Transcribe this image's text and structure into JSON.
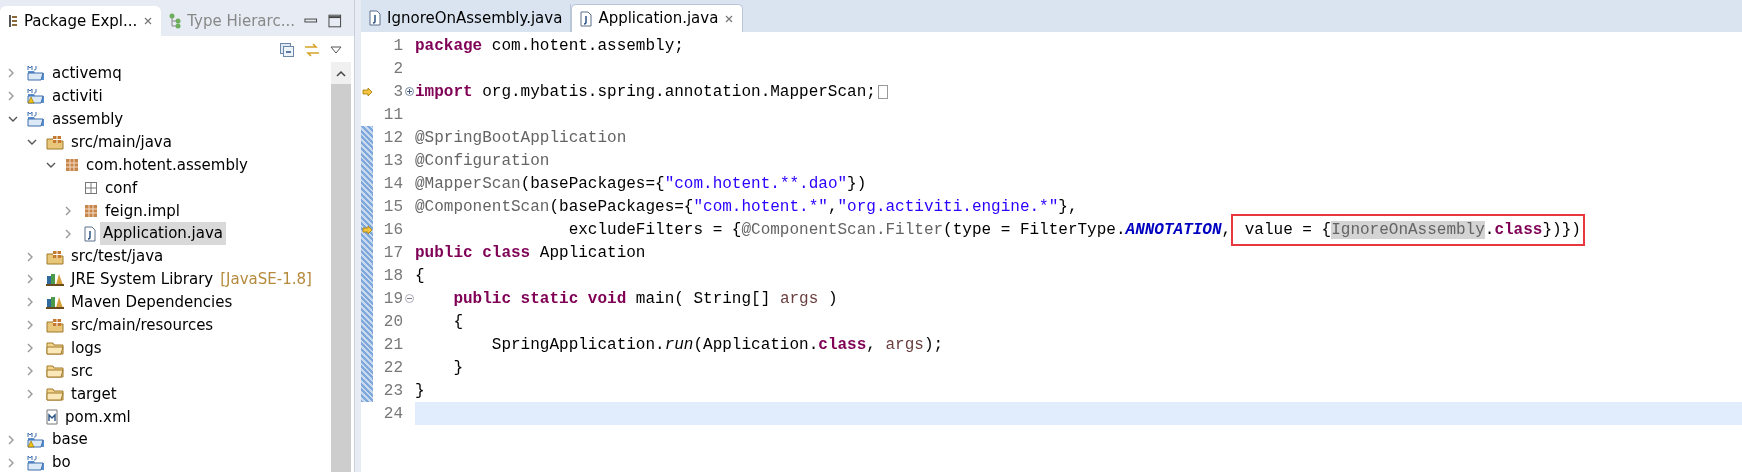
{
  "explorer": {
    "tabs": [
      {
        "label": "Package Expl...",
        "selected": true
      },
      {
        "label": "Type Hierarc...",
        "selected": false
      }
    ],
    "tree": [
      {
        "label": "activemq",
        "kind": "project",
        "warning": false,
        "expanded": false,
        "selected": false
      },
      {
        "label": "activiti",
        "kind": "project",
        "warning": true,
        "expanded": false,
        "selected": false
      },
      {
        "label": "assembly",
        "kind": "project",
        "warning": false,
        "expanded": true,
        "selected": false,
        "children": [
          {
            "label": "src/main/java",
            "kind": "source-folder",
            "expanded": true,
            "selected": false,
            "children": [
              {
                "label": "com.hotent.assembly",
                "kind": "package",
                "expanded": true,
                "selected": false,
                "children": [
                  {
                    "label": "conf",
                    "kind": "empty-package",
                    "selected": false
                  },
                  {
                    "label": "feign.impl",
                    "kind": "package",
                    "expanded": false,
                    "selected": false
                  },
                  {
                    "label": "Application.java",
                    "kind": "java-file",
                    "expanded": false,
                    "selected": true
                  }
                ]
              }
            ]
          },
          {
            "label": "src/test/java",
            "kind": "source-folder",
            "expanded": false,
            "selected": false
          },
          {
            "label": "JRE System Library",
            "decoration": "[JavaSE-1.8]",
            "kind": "library",
            "expanded": false,
            "selected": false
          },
          {
            "label": "Maven Dependencies",
            "kind": "library",
            "expanded": false,
            "selected": false
          },
          {
            "label": "src/main/resources",
            "kind": "source-folder",
            "expanded": false,
            "selected": false
          },
          {
            "label": "logs",
            "kind": "folder",
            "expanded": false,
            "selected": false
          },
          {
            "label": "src",
            "kind": "folder",
            "expanded": false,
            "selected": false
          },
          {
            "label": "target",
            "kind": "folder",
            "expanded": false,
            "selected": false
          },
          {
            "label": "pom.xml",
            "kind": "xml-file",
            "selected": false
          }
        ]
      },
      {
        "label": "base",
        "kind": "project",
        "warning": true,
        "expanded": false,
        "selected": false
      },
      {
        "label": "bo",
        "kind": "project",
        "warning": false,
        "expanded": false,
        "selected": false
      }
    ]
  },
  "editor": {
    "tabs": [
      {
        "label": "IgnoreOnAssembly.java",
        "selected": false,
        "closable": false
      },
      {
        "label": "Application.java",
        "selected": true,
        "closable": true
      }
    ],
    "lines": [
      {
        "number": "1",
        "arrow_marker": false,
        "changed": false,
        "current": false,
        "tokens": [
          {
            "kind": "keyword",
            "text": "package"
          },
          {
            "kind": "plain",
            "text": " com.hotent.assembly;"
          }
        ]
      },
      {
        "number": "2",
        "arrow_marker": false,
        "changed": false,
        "current": false
      },
      {
        "number": "3",
        "arrow_marker": true,
        "collapsed": true,
        "changed": false,
        "current": false,
        "folded_block": true,
        "tokens": [
          {
            "kind": "keyword",
            "text": "import"
          },
          {
            "kind": "plain",
            "text": " org.mybatis.spring.annotation.MapperScan;"
          }
        ]
      },
      {
        "number": "11",
        "arrow_marker": false,
        "changed": false,
        "current": false
      },
      {
        "number": "12",
        "arrow_marker": false,
        "changed": true,
        "current": false,
        "tokens": [
          {
            "kind": "annotation",
            "text": "@SpringBootApplication"
          }
        ]
      },
      {
        "number": "13",
        "arrow_marker": false,
        "changed": true,
        "current": false,
        "tokens": [
          {
            "kind": "annotation",
            "text": "@Configuration"
          }
        ]
      },
      {
        "number": "14",
        "arrow_marker": false,
        "changed": true,
        "current": false,
        "tokens": [
          {
            "kind": "annotation",
            "text": "@MapperScan"
          },
          {
            "kind": "plain",
            "text": "(basePackages={"
          },
          {
            "kind": "string",
            "text": "\"com.hotent.**.dao\""
          },
          {
            "kind": "plain",
            "text": "})"
          }
        ]
      },
      {
        "number": "15",
        "arrow_marker": false,
        "changed": true,
        "current": false,
        "tokens": [
          {
            "kind": "annotation",
            "text": "@ComponentScan"
          },
          {
            "kind": "plain",
            "text": "(basePackages={"
          },
          {
            "kind": "string",
            "text": "\"com.hotent.*\""
          },
          {
            "kind": "plain",
            "text": ","
          },
          {
            "kind": "string",
            "text": "\"org.activiti.engine.*\""
          },
          {
            "kind": "plain",
            "text": "},"
          }
        ]
      },
      {
        "number": "16",
        "arrow_marker": true,
        "changed": true,
        "current": false,
        "tokens": [
          {
            "kind": "plain",
            "text": "                excludeFilters = {"
          },
          {
            "kind": "annotation",
            "text": "@ComponentScan.Filter"
          },
          {
            "kind": "plain",
            "text": "(type = FilterType."
          },
          {
            "kind": "constant",
            "text": "ANNOTATION"
          },
          {
            "kind": "plain",
            "text": ","
          }
        ],
        "boxed_tokens": [
          {
            "kind": "plain",
            "text": " value = {"
          },
          {
            "kind": "occurrence",
            "text": "IgnoreOnAssembly"
          },
          {
            "kind": "plain",
            "text": "."
          },
          {
            "kind": "keyword",
            "text": "class"
          },
          {
            "kind": "plain",
            "text": "})})"
          }
        ]
      },
      {
        "number": "17",
        "arrow_marker": false,
        "changed": true,
        "current": false,
        "tokens": [
          {
            "kind": "keyword",
            "text": "public"
          },
          {
            "kind": "keyword",
            "text": " class"
          },
          {
            "kind": "plain",
            "text": " Application"
          }
        ]
      },
      {
        "number": "18",
        "arrow_marker": false,
        "changed": true,
        "current": false,
        "tokens": [
          {
            "kind": "plain",
            "text": "{"
          }
        ]
      },
      {
        "number": "19",
        "arrow_marker": false,
        "collapsed": false,
        "changed": true,
        "current": false,
        "tokens": [
          {
            "kind": "keyword",
            "text": "    public"
          },
          {
            "kind": "keyword",
            "text": " static"
          },
          {
            "kind": "keyword",
            "text": " void"
          },
          {
            "kind": "plain",
            "text": " main( String[] "
          },
          {
            "kind": "param",
            "text": "args"
          },
          {
            "kind": "plain",
            "text": " )"
          }
        ]
      },
      {
        "number": "20",
        "arrow_marker": false,
        "changed": true,
        "current": false,
        "tokens": [
          {
            "kind": "plain",
            "text": "    {"
          }
        ]
      },
      {
        "number": "21",
        "arrow_marker": false,
        "changed": true,
        "current": false,
        "tokens": [
          {
            "kind": "plain",
            "text": "        SpringApplication."
          },
          {
            "kind": "static-method",
            "text": "run"
          },
          {
            "kind": "plain",
            "text": "(Application."
          },
          {
            "kind": "keyword",
            "text": "class"
          },
          {
            "kind": "plain",
            "text": ", "
          },
          {
            "kind": "param",
            "text": "args"
          },
          {
            "kind": "plain",
            "text": ");"
          }
        ]
      },
      {
        "number": "22",
        "arrow_marker": false,
        "changed": true,
        "current": false,
        "tokens": [
          {
            "kind": "plain",
            "text": "    }"
          }
        ]
      },
      {
        "number": "23",
        "arrow_marker": false,
        "changed": true,
        "current": false,
        "tokens": [
          {
            "kind": "plain",
            "text": "}"
          }
        ]
      },
      {
        "number": "24",
        "arrow_marker": false,
        "changed": false,
        "current": true
      }
    ]
  }
}
